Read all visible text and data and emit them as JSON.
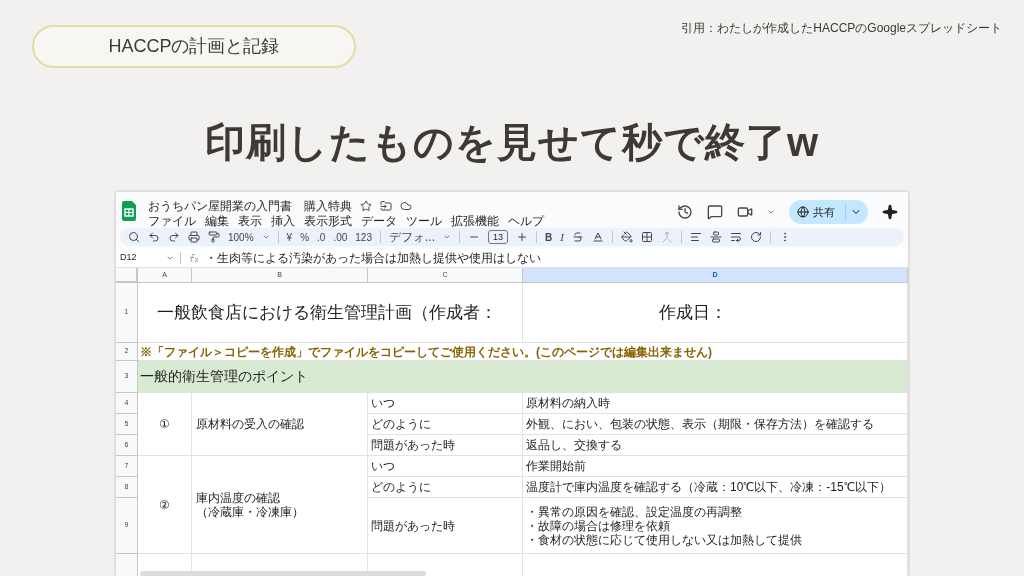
{
  "badge": "HACCPの計画と記録",
  "citation": "引用：わたしが作成したHACCPのGoogleスプレッドシート",
  "headline": "印刷したものを見せて秒で終了w",
  "sheet": {
    "title": "おうちパン屋開業の入門書　購入特典",
    "menus": [
      "ファイル",
      "編集",
      "表示",
      "挿入",
      "表示形式",
      "データ",
      "ツール",
      "拡張機能",
      "ヘルプ"
    ],
    "toolbar": {
      "zoom": "100%",
      "currency": "¥",
      "percent": "%",
      "decrease_decimal": ".0",
      "increase_decimal": ".00",
      "number_format": "123",
      "font": "デフォ...",
      "font_size": "13",
      "bold": "B",
      "italic": "I"
    },
    "share": "共有",
    "name_box": "D12",
    "formula": "・生肉等による汚染があった場合は加熱し提供や使用はしない",
    "columns": [
      {
        "label": "A",
        "selected": false
      },
      {
        "label": "B",
        "selected": false
      },
      {
        "label": "C",
        "selected": false
      },
      {
        "label": "D",
        "selected": true
      }
    ],
    "title_row": {
      "number": "1",
      "left": "一般飲食店における衛生管理計画（作成者：",
      "right": "作成日："
    },
    "note_row": {
      "number": "2",
      "text": "※「ファイル＞コピーを作成」でファイルをコピーしてご使用ください。(このページでは編集出来ません)"
    },
    "section_row": {
      "number": "3",
      "text": "一般的衛生管理のポイント"
    },
    "groups": [
      {
        "mark": "①",
        "name": [
          "原材料の受入の確認"
        ],
        "rows": [
          {
            "number": "4",
            "question": "いつ",
            "answer": [
              "原材料の納入時"
            ]
          },
          {
            "number": "5",
            "question": "どのように",
            "answer": [
              "外観、におい、包装の状態、表示（期限・保存方法）を確認する"
            ]
          },
          {
            "number": "6",
            "question": "問題があった時",
            "answer": [
              "返品し、交換する"
            ]
          }
        ]
      },
      {
        "mark": "②",
        "name": [
          "庫内温度の確認",
          "（冷蔵庫・冷凍庫）"
        ],
        "rows": [
          {
            "number": "7",
            "question": "いつ",
            "answer": [
              "作業開始前"
            ]
          },
          {
            "number": "8",
            "question": "どのように",
            "answer": [
              "温度計で庫内温度を確認する（冷蔵：10℃以下、冷凍：-15℃以下）"
            ]
          },
          {
            "number": "9",
            "question": "問題があった時",
            "answer": [
              "・異常の原因を確認、設定温度の再調整",
              "・故障の場合は修理を依頼",
              "・食材の状態に応じて使用しない又は加熱して提供"
            ]
          }
        ]
      }
    ]
  }
}
